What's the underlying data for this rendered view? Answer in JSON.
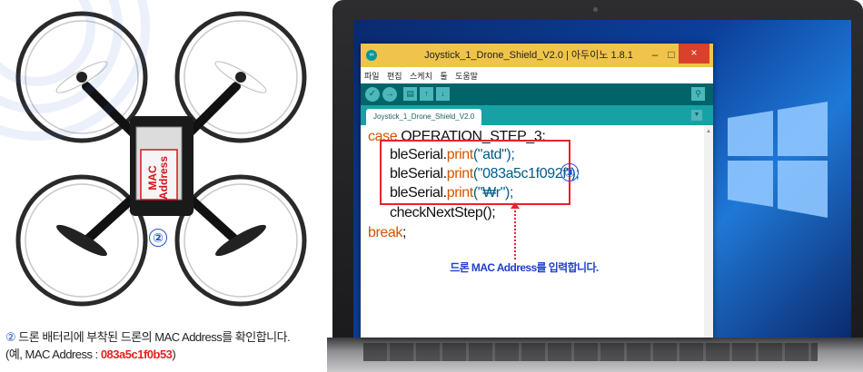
{
  "drone": {
    "mac_label": "MAC Address",
    "step_number": "②"
  },
  "caption": {
    "step_number": "②",
    "line1": "드론 배터리에 부착된 드론의 MAC Address를 확인합니다.",
    "line2_prefix": "(예, MAC Address : ",
    "mac_value": "083a5c1f0b53",
    "line2_suffix": ")"
  },
  "ide": {
    "title": "Joystick_1_Drone_Shield_V2.0 | 아두이노 1.8.1",
    "app_icon": "∞",
    "window_buttons": {
      "minimize": "–",
      "maximize": "□",
      "close": "×"
    },
    "menu": [
      "파일",
      "편집",
      "스케치",
      "툴",
      "도움말"
    ],
    "toolbar": {
      "verify": "✓",
      "upload": "→",
      "new": "▤",
      "open": "↑",
      "save": "↓",
      "serial_monitor": "⚲"
    },
    "tab_label": "Joystick_1_Drone_Shield_V2.0",
    "tab_menu": "▼",
    "code": {
      "case_kw": "case",
      "case_label": " OPERATION_STEP_3:",
      "obj": "bleSerial.",
      "print_fn": "print",
      "line1_arg": "(\"atd\");",
      "line2_arg": "(\"083a5c1f092f\");",
      "line3_arg": "(\"₩r\");",
      "check_call": "checkNextStep();",
      "break_stmt": "break",
      "break_suffix": ";"
    },
    "step_number": "③",
    "hint": "드론 MAC Address를 입력합니다."
  },
  "colors": {
    "accent_red": "#e5232a",
    "accent_blue": "#1f55c8",
    "arduino_teal": "#006468",
    "titlebar_yellow": "#f0c44a"
  }
}
